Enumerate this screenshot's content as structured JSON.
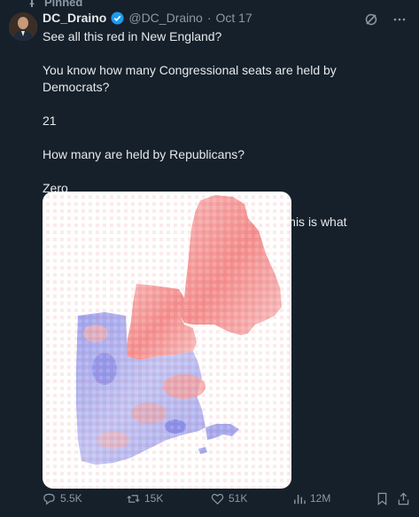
{
  "pinned_label": "Pinned",
  "author": {
    "name": "DC_Draino",
    "handle": "@DC_Draino",
    "date": "Oct 17"
  },
  "tweet": {
    "lines": [
      "See all this red in New England?",
      "You know how many Congressional seats are held by Democrats?",
      "21",
      "How many are held by Republicans?",
      "Zero",
      "Don't talk to us about gerrymandering when this is what Democrats do"
    ]
  },
  "actions": {
    "replies": "5.5K",
    "retweets": "15K",
    "likes": "51K",
    "views": "12M"
  },
  "colors": {
    "background": "#15202b",
    "text": "#e7e9ea",
    "muted": "#8b98a5",
    "verified": "#1d9bf0",
    "map_red": "#f08a8a",
    "map_blue": "#8a8ff0"
  }
}
